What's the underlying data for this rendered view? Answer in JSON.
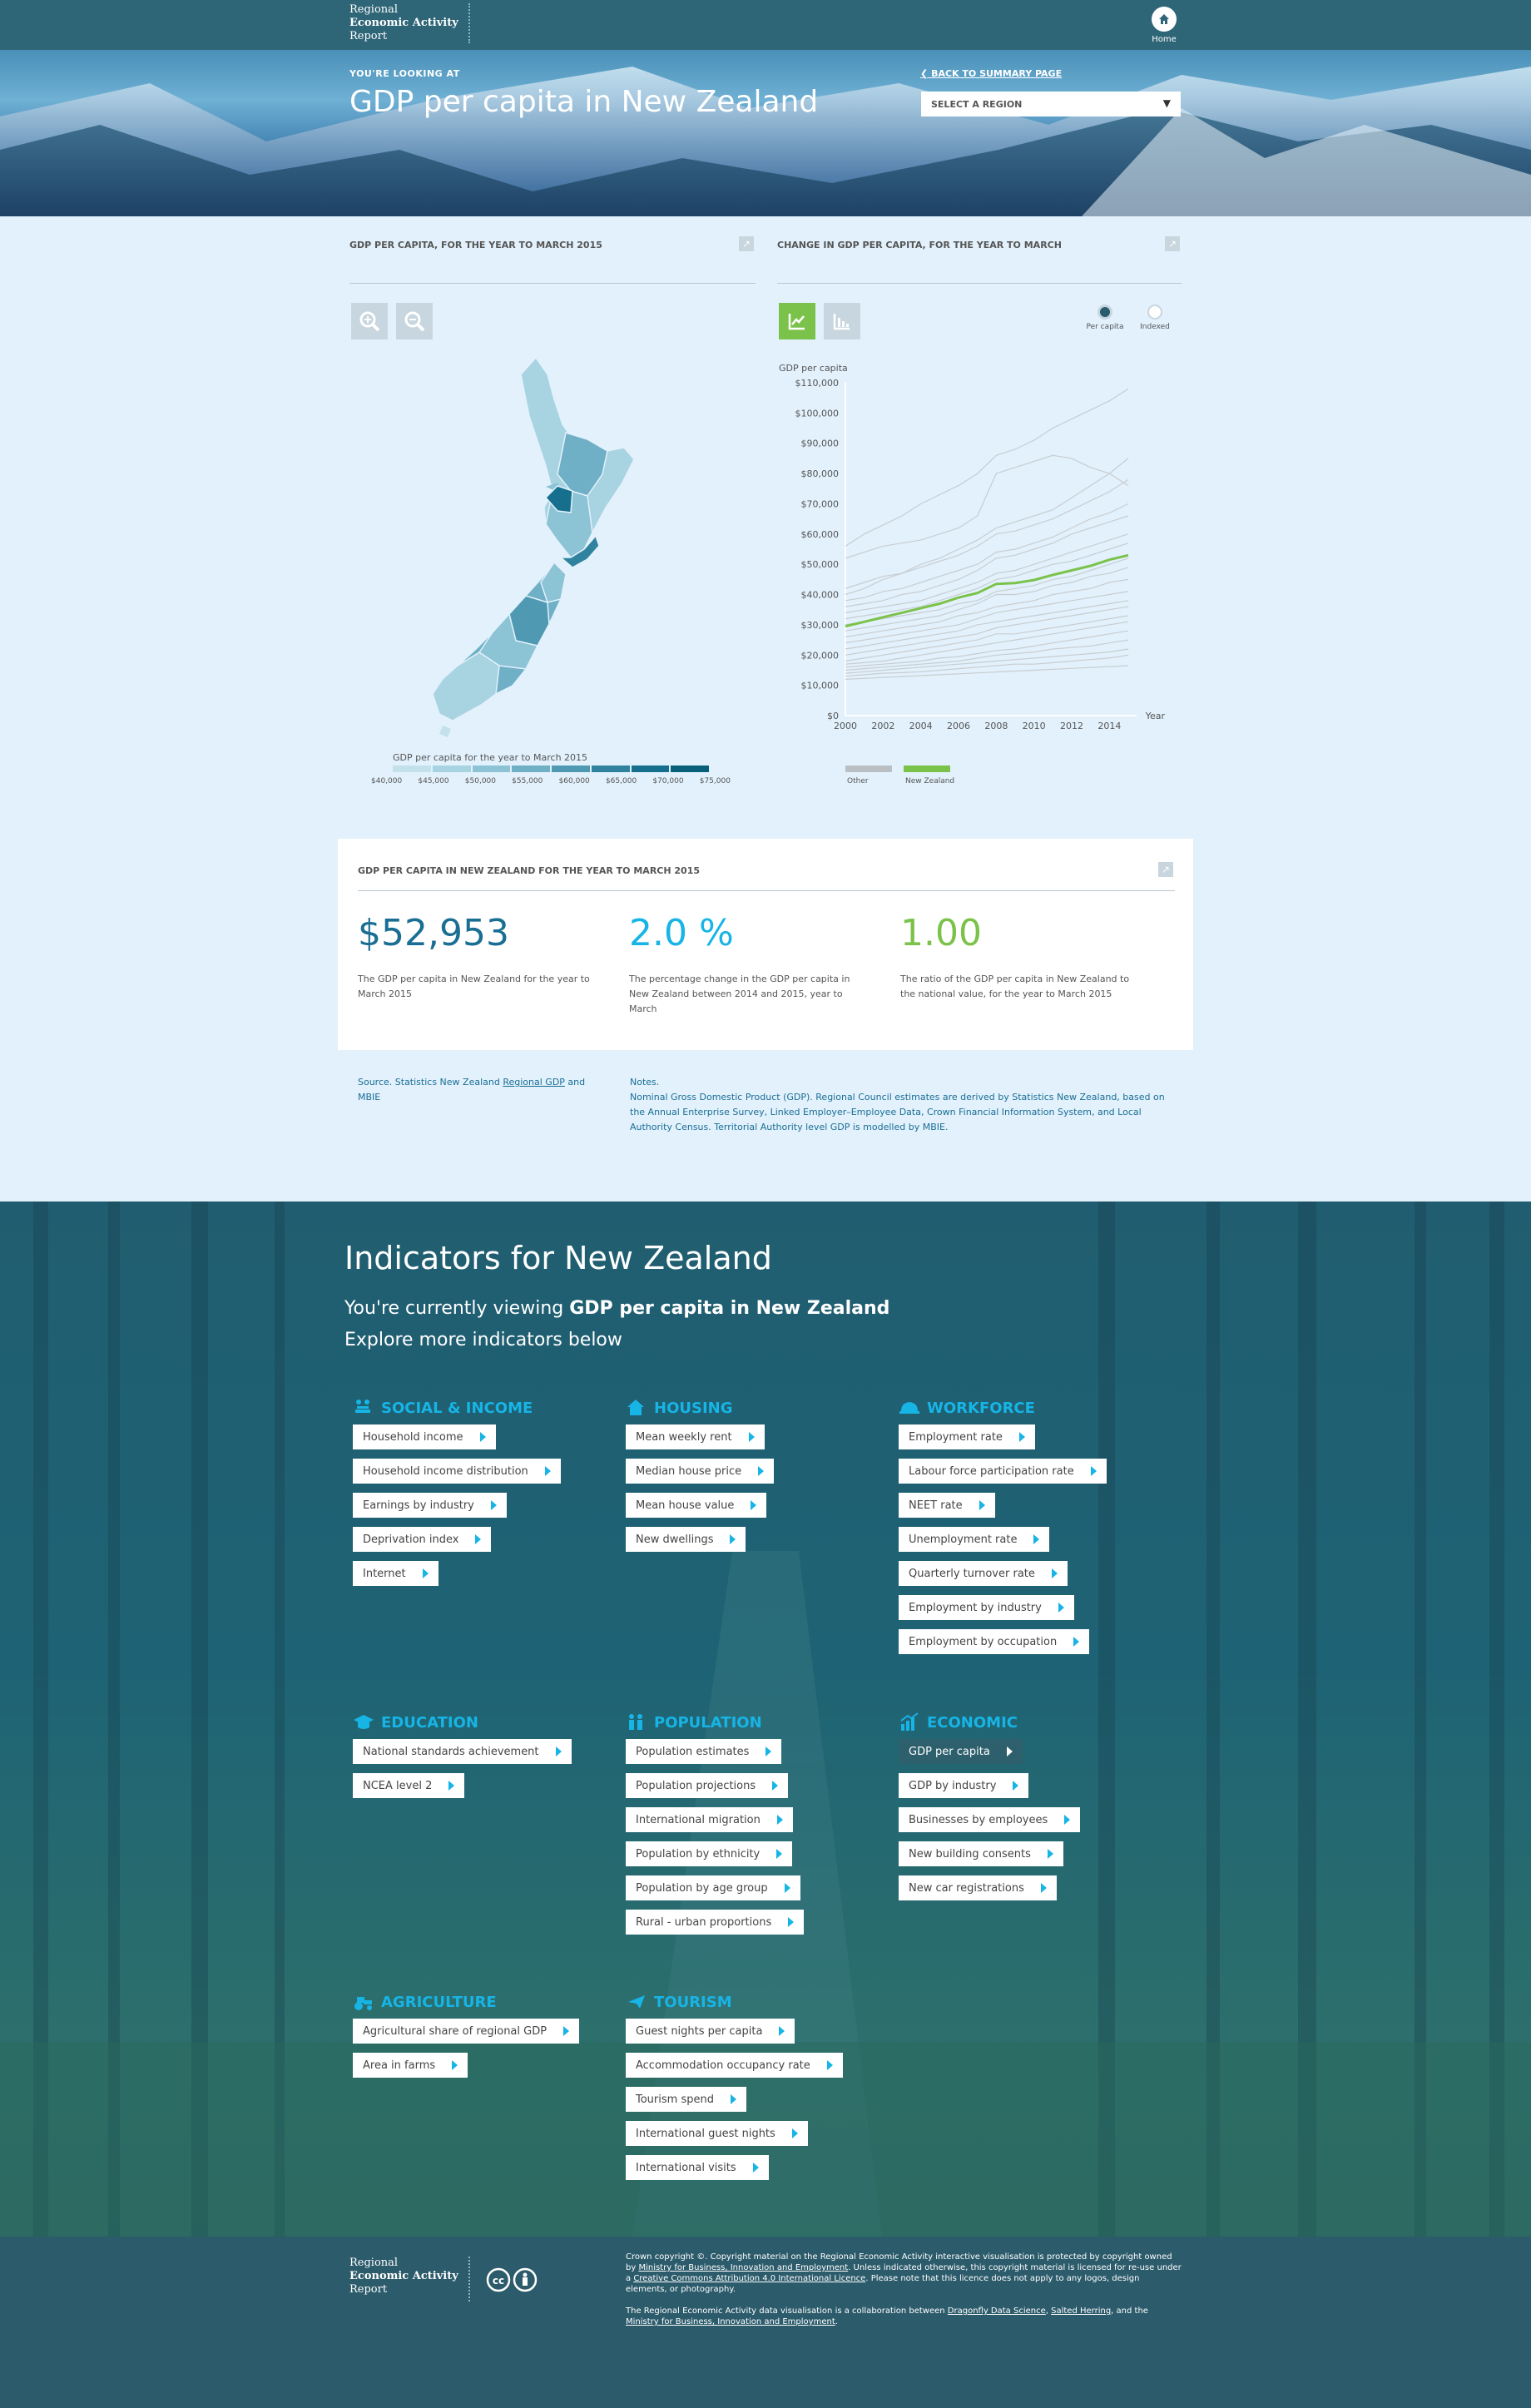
{
  "topbar": {
    "logo_line1": "Regional",
    "logo_line2": "Economic Activity",
    "logo_line3": "Report",
    "home_label": "Home"
  },
  "hero": {
    "eyebrow": "YOU'RE LOOKING AT",
    "title": "GDP per capita in New Zealand",
    "back_link": "BACK TO SUMMARY PAGE",
    "region_select": "SELECT A REGION"
  },
  "map_panel": {
    "title": "GDP PER CAPITA, FOR THE YEAR TO MARCH 2015",
    "legend_title": "GDP per capita for the year to March 2015",
    "legend_ticks": [
      "$40,000",
      "$45,000",
      "$50,000",
      "$55,000",
      "$60,000",
      "$65,000",
      "$70,000",
      "$75,000"
    ],
    "legend_colors": [
      "#c3e1ea",
      "#a8d3e0",
      "#8cc3d5",
      "#6fb0c6",
      "#4f9ab2",
      "#30839e",
      "#16708d",
      "#075f7a"
    ]
  },
  "line_panel": {
    "title": "CHANGE IN GDP PER CAPITA, FOR THE YEAR TO MARCH",
    "toggle_per_capita": "Per capita",
    "toggle_indexed": "Indexed",
    "legend_other": "Other",
    "legend_nz": "New Zealand"
  },
  "chart_data": {
    "type": "line",
    "ylabel": "GDP per capita",
    "xlabel": "Year",
    "x": [
      2000,
      2001,
      2002,
      2003,
      2004,
      2005,
      2006,
      2007,
      2008,
      2009,
      2010,
      2011,
      2012,
      2013,
      2014,
      2015
    ],
    "xticks": [
      "2000",
      "2002",
      "2004",
      "2006",
      "2008",
      "2010",
      "2012",
      "2014"
    ],
    "yticks": [
      "$0",
      "$10,000",
      "$20,000",
      "$30,000",
      "$40,000",
      "$50,000",
      "$60,000",
      "$70,000",
      "$80,000",
      "$90,000",
      "$100,000",
      "$110,000"
    ],
    "ylim": [
      0,
      110000
    ],
    "colors": {
      "other": "#c8cdd0",
      "nz": "#7bc24a"
    },
    "series": [
      {
        "name": "New Zealand",
        "values": [
          29500,
          31000,
          32500,
          34000,
          35500,
          37000,
          39000,
          40500,
          43500,
          43800,
          44800,
          46500,
          48000,
          49500,
          51500,
          53000
        ]
      },
      {
        "values": [
          56000,
          60000,
          63000,
          66000,
          70000,
          73000,
          76000,
          80000,
          86000,
          88000,
          91000,
          95000,
          98000,
          101000,
          104000,
          108000
        ]
      },
      {
        "values": [
          52000,
          54000,
          56000,
          57000,
          58000,
          60000,
          62000,
          66000,
          80000,
          82000,
          84000,
          86000,
          85000,
          82000,
          80000,
          76000
        ]
      },
      {
        "values": [
          40000,
          42000,
          45000,
          47000,
          50000,
          52000,
          55000,
          58000,
          62000,
          64000,
          66000,
          68000,
          72000,
          76000,
          80000,
          85000
        ]
      },
      {
        "values": [
          36000,
          37000,
          38000,
          40000,
          41000,
          43000,
          45000,
          48000,
          52000,
          53000,
          55000,
          57000,
          60000,
          62000,
          64000,
          66000
        ]
      },
      {
        "values": [
          34000,
          35000,
          36000,
          37000,
          38000,
          40000,
          42000,
          44000,
          47000,
          48000,
          50000,
          52000,
          54000,
          56000,
          58000,
          60000
        ]
      },
      {
        "values": [
          32000,
          33000,
          34000,
          35000,
          36000,
          38000,
          40000,
          42000,
          45000,
          46000,
          48000,
          50000,
          51000,
          53000,
          55000,
          57000
        ]
      },
      {
        "values": [
          30000,
          31000,
          32000,
          33000,
          34000,
          35000,
          37000,
          38000,
          41000,
          42000,
          43000,
          45000,
          46000,
          48000,
          50000,
          52000
        ]
      },
      {
        "values": [
          28000,
          29000,
          30000,
          31000,
          32000,
          33000,
          35000,
          37000,
          40000,
          40000,
          41000,
          43000,
          44000,
          46000,
          47000,
          49000
        ]
      },
      {
        "values": [
          26000,
          27000,
          28000,
          29000,
          30000,
          31000,
          33000,
          34000,
          36000,
          37000,
          38000,
          40000,
          41000,
          42000,
          44000,
          45000
        ]
      },
      {
        "values": [
          24000,
          25000,
          26000,
          27000,
          28000,
          29000,
          30000,
          32000,
          34000,
          35000,
          36000,
          37000,
          38000,
          39000,
          40000,
          41000
        ]
      },
      {
        "values": [
          22000,
          23000,
          24000,
          25000,
          26000,
          27000,
          28000,
          30000,
          31000,
          32000,
          33000,
          34000,
          35000,
          36000,
          37000,
          38000
        ]
      },
      {
        "values": [
          20000,
          21000,
          22000,
          23000,
          24000,
          25000,
          26000,
          27000,
          29000,
          30000,
          31000,
          32000,
          33000,
          34000,
          35000,
          36000
        ]
      },
      {
        "values": [
          18000,
          19000,
          20000,
          21000,
          22000,
          23000,
          24000,
          25000,
          27000,
          27000,
          28000,
          29000,
          30000,
          31000,
          32000,
          33000
        ]
      },
      {
        "values": [
          17000,
          17500,
          18000,
          19000,
          20000,
          21000,
          22000,
          23000,
          24000,
          25000,
          26000,
          27000,
          28000,
          29000,
          30000,
          31000
        ]
      },
      {
        "values": [
          16000,
          16500,
          17000,
          17500,
          18000,
          19000,
          19500,
          20500,
          21500,
          22000,
          23000,
          24000,
          25000,
          26000,
          27000,
          28000
        ]
      },
      {
        "values": [
          15000,
          15500,
          16000,
          16500,
          17000,
          17500,
          18000,
          19000,
          20000,
          20500,
          21000,
          22000,
          22500,
          23000,
          24000,
          25000
        ]
      },
      {
        "values": [
          14000,
          14500,
          15000,
          15500,
          16000,
          16500,
          17000,
          17500,
          18000,
          18500,
          19000,
          19500,
          20000,
          20500,
          21000,
          22000
        ]
      },
      {
        "values": [
          13000,
          13500,
          14000,
          14200,
          14500,
          15000,
          15500,
          16000,
          16500,
          17000,
          17000,
          17500,
          18000,
          18500,
          19000,
          20000
        ]
      },
      {
        "values": [
          12000,
          12300,
          12600,
          12900,
          13200,
          13500,
          13800,
          14100,
          14400,
          14700,
          15000,
          15300,
          15600,
          15900,
          16200,
          16500
        ]
      },
      {
        "values": [
          42000,
          44000,
          46000,
          47000,
          49000,
          51000,
          53000,
          56000,
          60000,
          61000,
          63000,
          65000,
          68000,
          71000,
          74000,
          78000
        ]
      },
      {
        "values": [
          38000,
          39000,
          41000,
          42000,
          44000,
          46000,
          48000,
          50000,
          54000,
          55000,
          57000,
          59000,
          62000,
          65000,
          67000,
          70000
        ]
      }
    ]
  },
  "summary": {
    "title": "GDP PER CAPITA IN NEW ZEALAND FOR THE YEAR TO MARCH 2015",
    "value1": "$52,953",
    "desc1": "The GDP per capita in New Zealand for the year to March 2015",
    "value2": "2.0 %",
    "desc2": "The percentage change in the GDP per capita in New Zealand between 2014 and 2015, year to March",
    "value3": "1.00",
    "desc3": "The ratio of the GDP per capita in New Zealand to the national value, for the year to March 2015",
    "colors": {
      "value1": "#1a6e94",
      "value2": "#17b4e6",
      "value3": "#7bc24a"
    }
  },
  "source": {
    "prefix": "Source. Statistics New Zealand ",
    "link": "Regional GDP",
    "suffix": " and MBIE",
    "notes_title": "Notes.",
    "notes_body": "Nominal Gross Domestic Product (GDP). Regional Council estimates are derived by Statistics New Zealand, based on the Annual Enterprise Survey, Linked Employer–Employee Data, Crown Financial Information System, and Local Authority Census. Territorial Authority level GDP is modelled by MBIE."
  },
  "indicators": {
    "heading": "Indicators for New Zealand",
    "viewing_prefix": "You're currently viewing ",
    "viewing_bold": "GDP per capita in New Zealand",
    "explore": "Explore more indicators below",
    "categories": [
      {
        "label": "SOCIAL & INCOME",
        "icon": "people-money-icon",
        "items": [
          "Household income",
          "Household income distribution",
          "Earnings by industry",
          "Deprivation index",
          "Internet"
        ]
      },
      {
        "label": "HOUSING",
        "icon": "house-icon",
        "items": [
          "Mean weekly rent",
          "Median house price",
          "Mean house value",
          "New dwellings"
        ]
      },
      {
        "label": "WORKFORCE",
        "icon": "hard-hat-icon",
        "items": [
          "Employment rate",
          "Labour force participation rate",
          "NEET rate",
          "Unemployment rate",
          "Quarterly turnover rate",
          "Employment by industry",
          "Employment by occupation"
        ]
      },
      {
        "label": "EDUCATION",
        "icon": "graduation-cap-icon",
        "items": [
          "National standards achievement",
          "NCEA level 2"
        ]
      },
      {
        "label": "POPULATION",
        "icon": "population-icon",
        "items": [
          "Population estimates",
          "Population projections",
          "International migration",
          "Population by ethnicity",
          "Population by age group",
          "Rural - urban proportions"
        ]
      },
      {
        "label": "ECONOMIC",
        "icon": "economic-chart-icon",
        "items": [
          "GDP per capita",
          "GDP by industry",
          "Businesses by employees",
          "New building consents",
          "New car registrations"
        ]
      },
      {
        "label": "AGRICULTURE",
        "icon": "tractor-icon",
        "items": [
          "Agricultural share of regional GDP",
          "Area in farms"
        ]
      },
      {
        "label": "TOURISM",
        "icon": "plane-icon",
        "items": [
          "Guest nights per capita",
          "Accommodation occupancy rate",
          "Tourism spend",
          "International guest nights",
          "International visits"
        ]
      }
    ]
  },
  "footer": {
    "copy1_a": "Crown copyright ©. Copyright material on the Regional Economic Activity interactive visualisation is protected by copyright owned by ",
    "copy1_link1": "Ministry for Business, Innovation and Employment",
    "copy1_b": ". Unless indicated otherwise, this copyright material is licensed for re-use under a ",
    "copy1_link2": "Creative Commons Attribution 4.0 International Licence",
    "copy1_c": ". Please note that this licence does not apply to any logos, design elements, or photography.",
    "copy2_a": "The Regional Economic Activity data visualisation is a collaboration between ",
    "copy2_link1": "Dragonfly Data Science",
    "copy2_b": ", ",
    "copy2_link2": "Salted Herring",
    "copy2_c": ", and the ",
    "copy2_link3": "Ministry for Business, Innovation and Employment",
    "copy2_d": "."
  }
}
